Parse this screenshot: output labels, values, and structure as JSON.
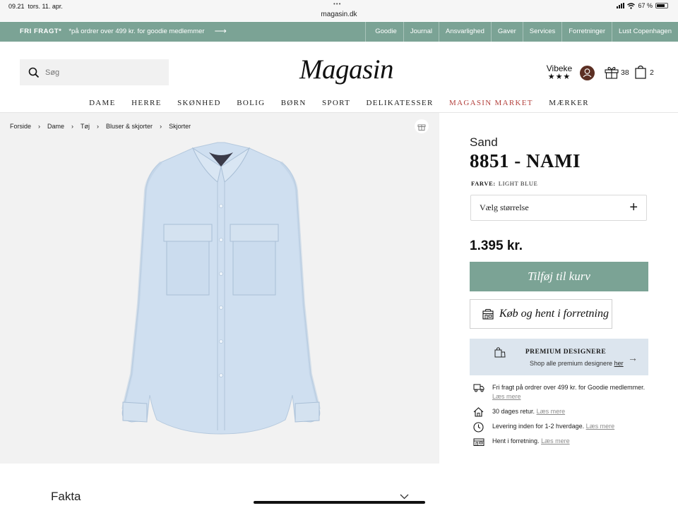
{
  "status_bar": {
    "time": "09.21",
    "date": "tors. 11. apr.",
    "dots": "•••",
    "url": "magasin.dk",
    "battery": "67 %",
    "battery_level": 0.67
  },
  "promo": {
    "title": "FRI FRAGT*",
    "text": "*på ordrer over 499 kr. for goodie medlemmer",
    "arrow_icon": "arrow-right-icon",
    "links": [
      "Goodie",
      "Journal",
      "Ansvarlighed",
      "Gaver",
      "Services",
      "Forretninger",
      "Lust Copenhagen"
    ],
    "bg_color": "#7ba395"
  },
  "header": {
    "search_placeholder": "Søg",
    "logo": "Magasin",
    "user_name": "Vibeke",
    "user_stars": "★★★",
    "gift_count": "38",
    "bag_count": "2"
  },
  "main_nav": [
    "DAME",
    "HERRE",
    "SKØNHED",
    "BOLIG",
    "BØRN",
    "SPORT",
    "DELIKATESSER",
    "MAGASIN MARKET",
    "MÆRKER"
  ],
  "breadcrumb": [
    "Forside",
    "Dame",
    "Tøj",
    "Bluser & skjorter",
    "Skjorter"
  ],
  "breadcrumb_sep": "›",
  "product": {
    "brand": "Sand",
    "name": "8851 - NAMI",
    "color_label": "FARVE:",
    "color_value": "LIGHT BLUE",
    "size_placeholder": "Vælg størrelse",
    "size_plus": "+",
    "price": "1.395 kr.",
    "add_to_cart": "Tilføj til kurv",
    "store_pickup": "Køb og hent i forretning"
  },
  "premium": {
    "title": "PREMIUM DESIGNERE",
    "subtitle": "Shop alle premium designere",
    "link": "her",
    "arrow": "→"
  },
  "usps": [
    {
      "icon": "truck-icon",
      "text": "Fri fragt på ordrer over 499 kr. for Goodie medlemmer.",
      "link": "Læs mere"
    },
    {
      "icon": "home-icon",
      "text": "30 dages retur.",
      "link": "Læs mere"
    },
    {
      "icon": "clock-icon",
      "text": "Levering inden for 1-2 hverdage.",
      "link": "Læs mere"
    },
    {
      "icon": "store-icon",
      "text": "Hent i forretning.",
      "link": "Læs mere"
    }
  ],
  "fakta": "Fakta"
}
